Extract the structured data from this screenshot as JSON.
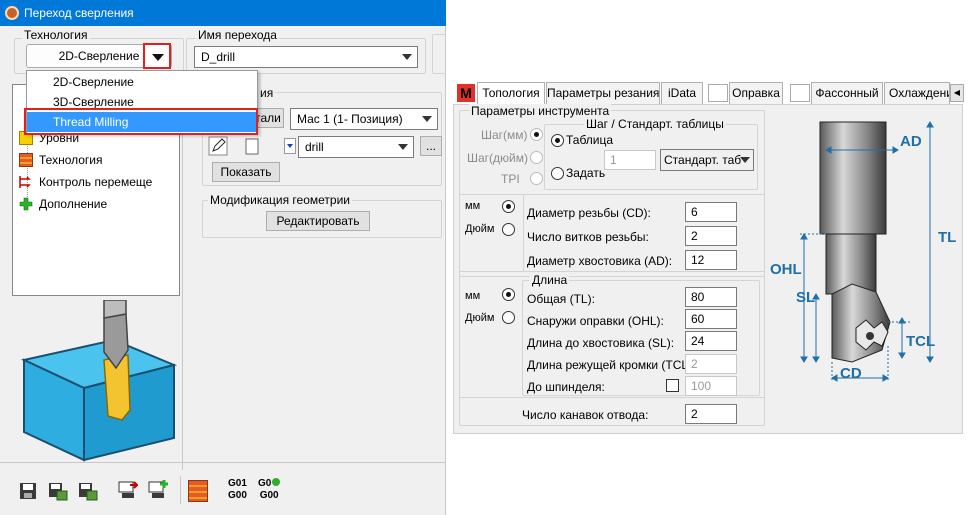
{
  "window": {
    "title": "Переход сверления"
  },
  "technology": {
    "label": "Технология",
    "value": "2D-Сверление",
    "options": [
      "2D-Сверление",
      "3D-Сверление",
      "Thread Milling"
    ],
    "selected": "Thread Milling"
  },
  "transition_name": {
    "label": "Имя перехода",
    "value": "D_drill"
  },
  "tree": {
    "items": [
      "Уровни",
      "Технология",
      "Контроль перемеще",
      "Дополнение"
    ]
  },
  "mid": {
    "group_title_partial": "ия",
    "tool_button_partial": "тали",
    "machine_combo": "Мас 1 (1- Позиция)",
    "tool_combo": "drill",
    "ellipsis": "...",
    "show_button": "Показать",
    "geom_group": "Модификация геометрии",
    "edit_button": "Редактировать"
  },
  "bottom_toolbar": {
    "g01_g00": [
      "G01",
      "G00"
    ],
    "g0_g00": [
      "G0",
      "G00"
    ]
  },
  "right_panel": {
    "tabs": [
      "Топология",
      "Параметры резания",
      "iData",
      "Оправка",
      "Фассонный",
      "Охлаждени"
    ],
    "tab_logo": "M",
    "tool_params_group": "Параметры инструмента",
    "units": {
      "mm": "Шаг(мм)",
      "inch": "Шаг(дюйм)",
      "tpi": "TPI"
    },
    "pitch_group": "Шаг / Стандарт. таблицы",
    "pitch_table": "Таблица",
    "pitch_set": "Задать",
    "pitch_value": "1",
    "pitch_standard": "Стандарт. таб",
    "unit_mm": "мм",
    "unit_inch": "Дюйм",
    "thread_diameter": {
      "label": "Диаметр резьбы (CD):",
      "value": "6"
    },
    "thread_turns": {
      "label": "Число витков резьбы:",
      "value": "2"
    },
    "shank_diameter": {
      "label": "Диаметр хвостовика (AD):",
      "value": "12"
    },
    "length_group": "Длина",
    "total_length": {
      "label": "Общая (TL):",
      "value": "80"
    },
    "outside_holder": {
      "label": "Снаружи оправки (OHL):",
      "value": "60"
    },
    "to_shank": {
      "label": "Длина до хвостовика (SL):",
      "value": "24"
    },
    "cutting_edge": {
      "label": "Длина режущей кромки (TCL):",
      "value": "2"
    },
    "to_spindle": {
      "label": "До шпинделя:",
      "value": "100"
    },
    "retract_grooves": {
      "label": "Число канавок отвода:",
      "value": "2"
    }
  },
  "diagram": {
    "AD": "AD",
    "TL": "TL",
    "OHL": "OHL",
    "SL": "SL",
    "TCL": "TCL",
    "CD": "CD"
  },
  "colors": {
    "title_bar": "#0078d7",
    "highlight": "#3399ff",
    "red_callout": "#e02020",
    "diagram_blue": "#1f6fa8"
  }
}
